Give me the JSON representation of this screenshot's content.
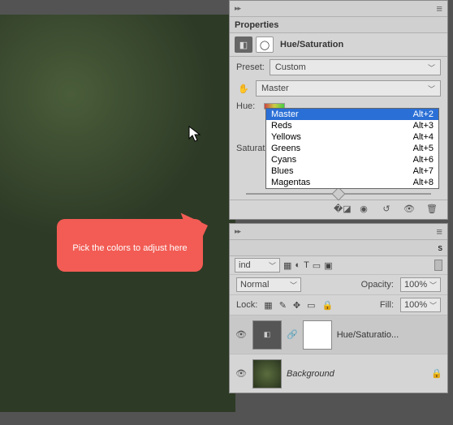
{
  "properties": {
    "panel_title": "Properties",
    "adj_label": "Hue/Saturation",
    "preset_label": "Preset:",
    "preset_value": "Custom",
    "range_selected": "Master",
    "hue_label": "Hue:",
    "sat_label": "Saturation:",
    "range_items": [
      {
        "label": "Master",
        "shortcut": "Alt+2"
      },
      {
        "label": "Reds",
        "shortcut": "Alt+3"
      },
      {
        "label": "Yellows",
        "shortcut": "Alt+4"
      },
      {
        "label": "Greens",
        "shortcut": "Alt+5"
      },
      {
        "label": "Cyans",
        "shortcut": "Alt+6"
      },
      {
        "label": "Blues",
        "shortcut": "Alt+7"
      },
      {
        "label": "Magentas",
        "shortcut": "Alt+8"
      }
    ]
  },
  "layers": {
    "kind_value": "Kind",
    "blend_mode": "Normal",
    "opacity_label": "Opacity:",
    "opacity_value": "100%",
    "lock_label": "Lock:",
    "fill_label": "Fill:",
    "fill_value": "100%",
    "items": [
      {
        "name": "Hue/Saturatio..."
      },
      {
        "name": "Background"
      }
    ]
  },
  "callout": {
    "text": "Pick the colors to adjust here"
  }
}
